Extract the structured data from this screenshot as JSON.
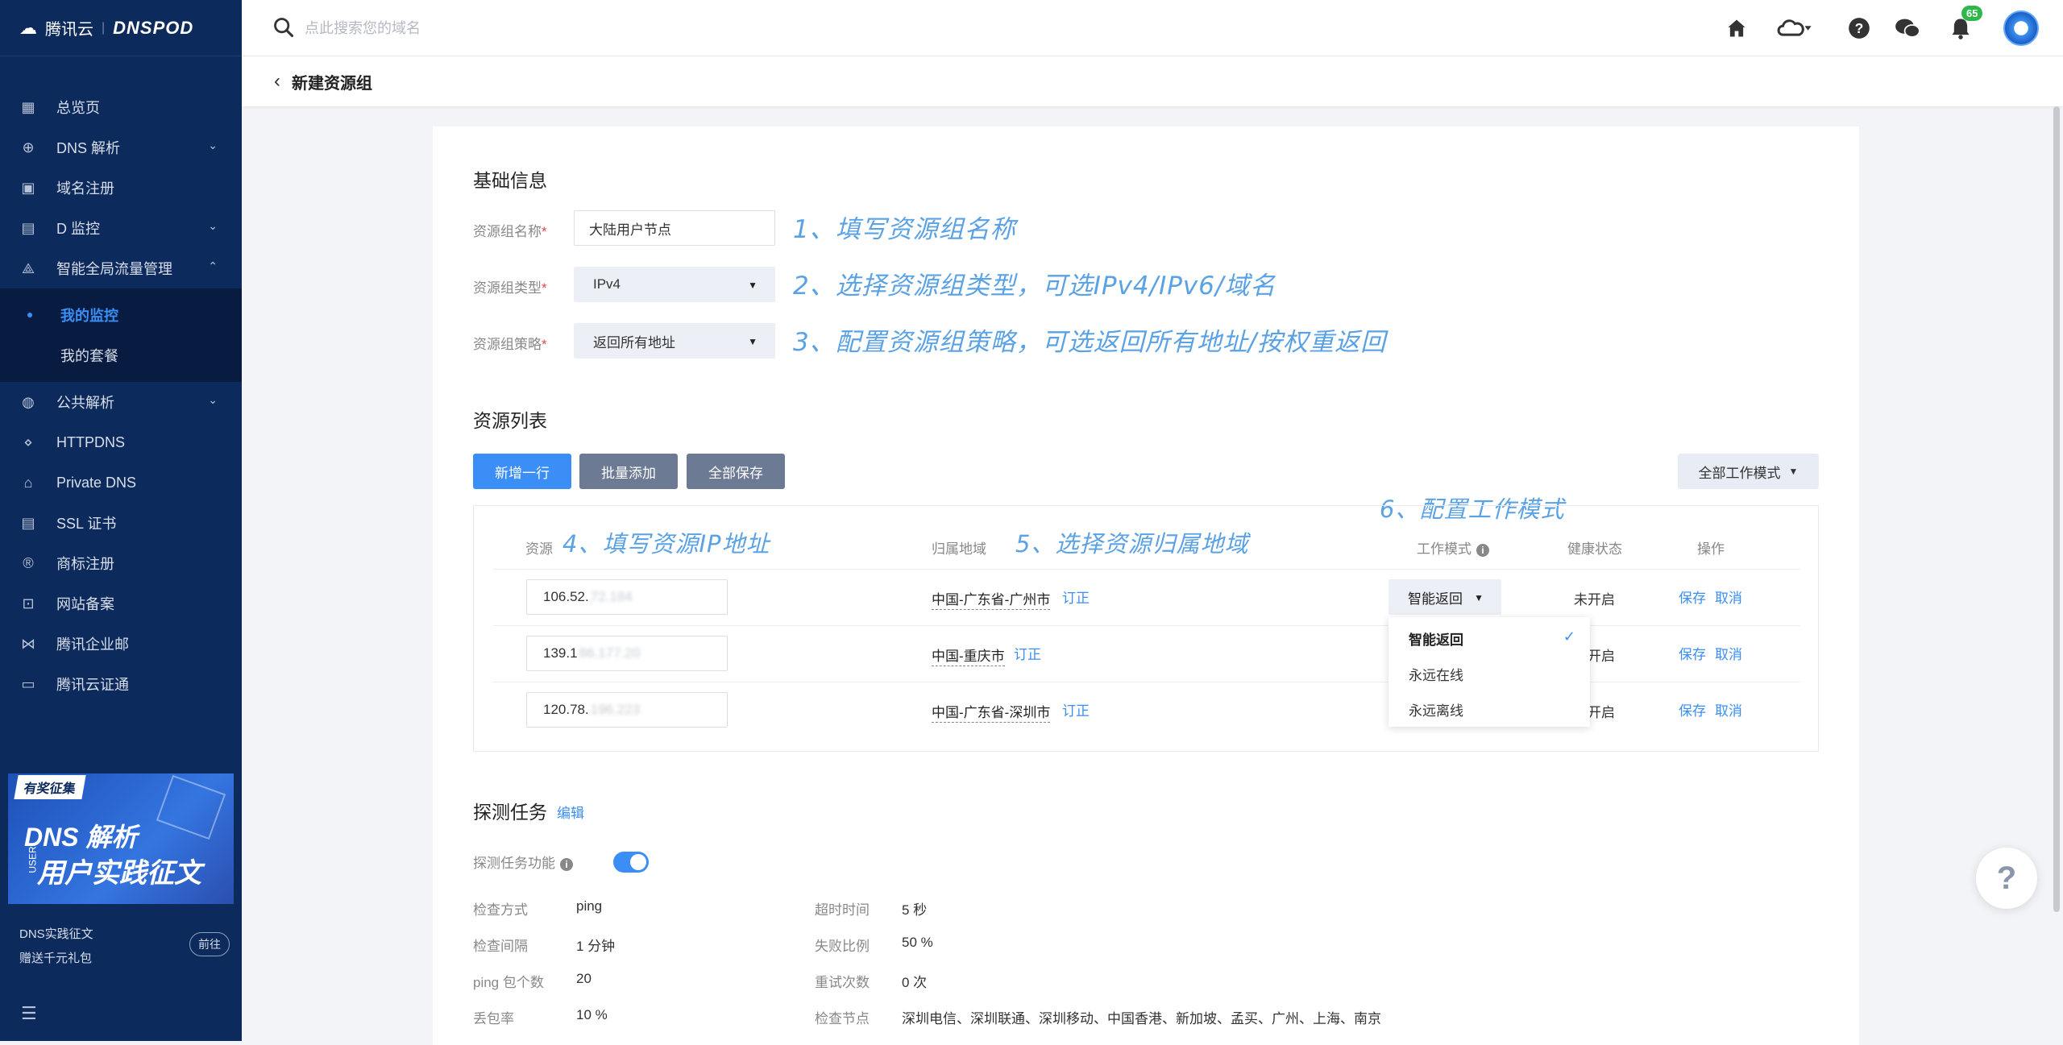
{
  "brand": {
    "logo_text": "腾讯云",
    "product": "DNSPOD"
  },
  "sidebar": {
    "items": [
      {
        "label": "总览页",
        "icon": "dashboard-icon"
      },
      {
        "label": "DNS 解析",
        "icon": "globe-icon",
        "chevron": "down"
      },
      {
        "label": "域名注册",
        "icon": "domain-icon"
      },
      {
        "label": "D 监控",
        "icon": "monitor-icon",
        "chevron": "down"
      },
      {
        "label": "智能全局流量管理",
        "icon": "traffic-icon",
        "chevron": "up"
      }
    ],
    "sub_items": [
      {
        "label": "我的监控",
        "active": true
      },
      {
        "label": "我的套餐",
        "active": false
      }
    ],
    "items2": [
      {
        "label": "公共解析",
        "icon": "public-dns-icon",
        "chevron": "down"
      },
      {
        "label": "HTTPDNS",
        "icon": "httpdns-icon"
      },
      {
        "label": "Private DNS",
        "icon": "private-dns-icon"
      },
      {
        "label": "SSL 证书",
        "icon": "ssl-icon"
      },
      {
        "label": "商标注册",
        "icon": "trademark-icon"
      },
      {
        "label": "网站备案",
        "icon": "icp-icon"
      },
      {
        "label": "腾讯企业邮",
        "icon": "mail-icon"
      },
      {
        "label": "腾讯云证通",
        "icon": "cert-icon"
      }
    ],
    "promo": {
      "tag": "有奖征集",
      "headline1": "DNS 解析",
      "headline2": "用户实践征文",
      "side_text": "USER",
      "line1": "DNS实践征文",
      "line2": "赠送千元礼包",
      "button": "前往"
    }
  },
  "topbar": {
    "search_placeholder": "点此搜索您的域名",
    "notification_count": "65"
  },
  "page": {
    "title": "新建资源组"
  },
  "basic": {
    "section_title": "基础信息",
    "name_label": "资源组名称",
    "name_value": "大陆用户节点",
    "type_label": "资源组类型",
    "type_value": "IPv4",
    "strategy_label": "资源组策略",
    "strategy_value": "返回所有地址",
    "required_mark": "*"
  },
  "annotations": {
    "a1": "1、填写资源组名称",
    "a2": "2、选择资源组类型，可选IPv4/IPv6/域名",
    "a3": "3、配置资源组策略，可选返回所有地址/按权重返回",
    "a4": "4、填写资源IP地址",
    "a5": "5、选择资源归属地域",
    "a6": "6、配置工作模式"
  },
  "resources": {
    "section_title": "资源列表",
    "add_row": "新增一行",
    "bulk_add": "批量添加",
    "save_all": "全部保存",
    "all_mode": "全部工作模式",
    "headers": {
      "resource": "资源",
      "region": "归属地域",
      "mode": "工作模式",
      "health": "健康状态",
      "ops": "操作"
    },
    "rows": [
      {
        "ip_prefix": "106.52.",
        "ip_blur": "72.184",
        "region": "中国-广东省-广州市",
        "fix": "订正",
        "health": "未开启",
        "save": "保存",
        "cancel": "取消"
      },
      {
        "ip_prefix": "139.1",
        "ip_blur": "86.177.20",
        "region": "中国-重庆市",
        "fix": "订正",
        "health": "开启",
        "save": "保存",
        "cancel": "取消"
      },
      {
        "ip_prefix": "120.78.",
        "ip_blur": "196.223",
        "region": "中国-广东省-深圳市",
        "fix": "订正",
        "health": "开启",
        "save": "保存",
        "cancel": "取消"
      }
    ],
    "mode_value": "智能返回",
    "mode_options": [
      "智能返回",
      "永远在线",
      "永远离线"
    ]
  },
  "probe": {
    "section_title": "探测任务",
    "edit": "编辑",
    "toggle_label": "探测任务功能",
    "toggle_on": true,
    "left": [
      {
        "k": "检查方式",
        "v": "ping"
      },
      {
        "k": "检查间隔",
        "v": "1 分钟"
      },
      {
        "k": "ping 包个数",
        "v": "20"
      },
      {
        "k": "丢包率",
        "v": "10 %"
      }
    ],
    "right": [
      {
        "k": "超时时间",
        "v": "5 秒"
      },
      {
        "k": "失败比例",
        "v": "50 %"
      },
      {
        "k": "重试次数",
        "v": "0 次"
      },
      {
        "k": "检查节点",
        "v": "深圳电信、深圳联通、深圳移动、中国香港、新加坡、孟买、广州、上海、南京"
      }
    ]
  },
  "help": {
    "label": "?"
  }
}
